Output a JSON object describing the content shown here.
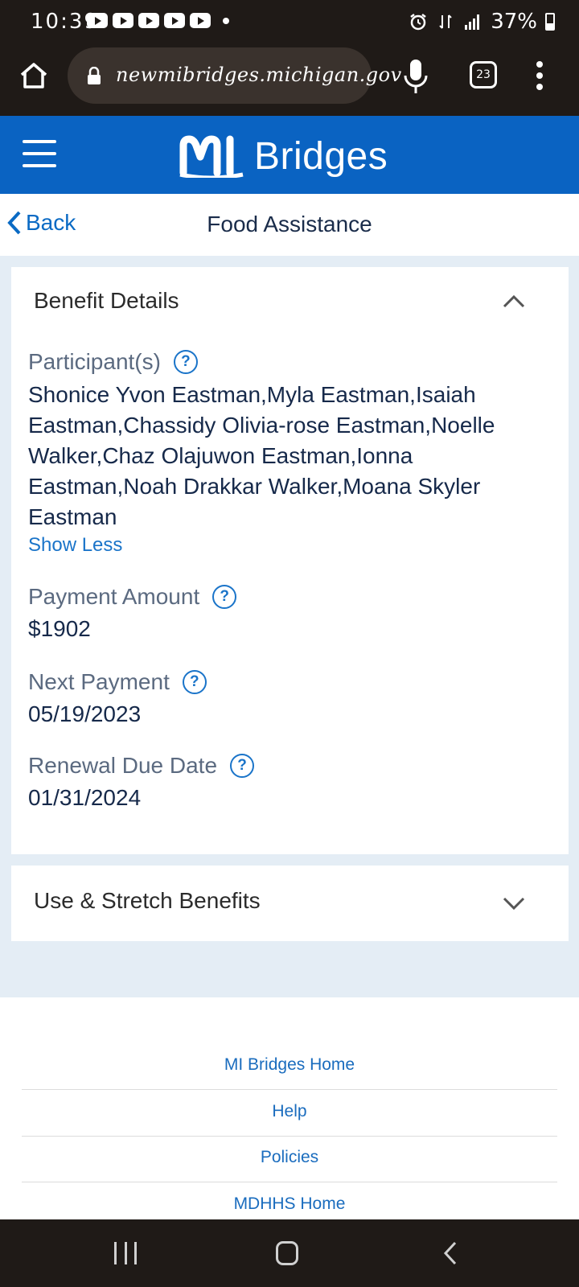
{
  "status_bar": {
    "time": "10:39",
    "battery": "37%",
    "notification_icons": [
      "youtube-icon",
      "youtube-icon",
      "youtube-icon",
      "youtube-icon",
      "youtube-icon"
    ]
  },
  "browser": {
    "url": "newmibridges.michigan.gov",
    "tab_count": "23"
  },
  "header": {
    "logo_mark": "MI",
    "logo_text": "Bridges",
    "brand_color": "#0a63c2"
  },
  "subheader": {
    "back_label": "Back",
    "title": "Food Assistance"
  },
  "benefit_details": {
    "heading": "Benefit Details",
    "participants_label": "Participant(s)",
    "participants_lines": [
      "Shonice Yvon Eastman,Myla Eastman,Isaiah",
      "Eastman,Chassidy Olivia-rose Eastman,Noelle",
      "Walker,Chaz Olajuwon Eastman,Ionna",
      "Eastman,Noah Drakkar Walker,Moana Skyler",
      "Eastman"
    ],
    "show_less": "Show Less",
    "payment_amount_label": "Payment Amount",
    "payment_amount": "$1902",
    "next_payment_label": "Next Payment",
    "next_payment": "05/19/2023",
    "renewal_label": "Renewal Due Date",
    "renewal_date": "01/31/2024",
    "help_glyph": "?"
  },
  "stretch": {
    "heading": "Use & Stretch Benefits"
  },
  "footer": {
    "links": [
      "MI Bridges Home",
      "Help",
      "Policies",
      "MDHHS Home"
    ]
  }
}
